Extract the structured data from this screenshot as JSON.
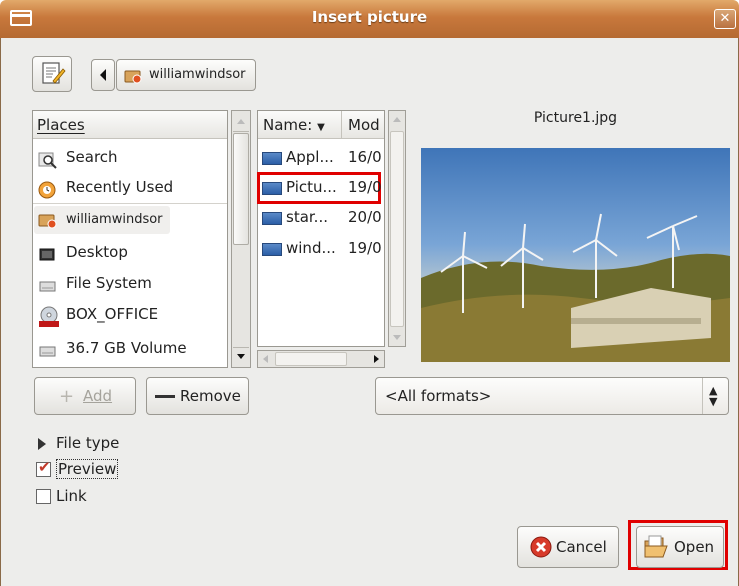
{
  "window": {
    "title": "Insert picture"
  },
  "location": {
    "breadcrumb": "williamwindsor"
  },
  "places": {
    "header": "Places",
    "items": [
      {
        "label": "Search",
        "icon": "search-icon"
      },
      {
        "label": "Recently Used",
        "icon": "recent-icon"
      },
      {
        "label": "williamwindsor",
        "icon": "home-folder-icon"
      },
      {
        "label": "Desktop",
        "icon": "desktop-icon"
      },
      {
        "label": "File System",
        "icon": "drive-icon"
      },
      {
        "label": "BOX_OFFICE",
        "icon": "cdrom-icon"
      },
      {
        "label": "36.7 GB Volume",
        "icon": "drive-icon"
      }
    ]
  },
  "files": {
    "columns": {
      "name": "Name:",
      "modified": "Mod"
    },
    "rows": [
      {
        "name": "Appl...",
        "modified": "16/0"
      },
      {
        "name": "Pictu...",
        "modified": "19/0",
        "selected": true
      },
      {
        "name": "star...",
        "modified": "20/0"
      },
      {
        "name": "wind...",
        "modified": "19/0"
      }
    ]
  },
  "preview": {
    "filename": "Picture1.jpg"
  },
  "buttons": {
    "add": "Add",
    "remove": "Remove",
    "cancel": "Cancel",
    "open": "Open"
  },
  "filter": {
    "selected": "<All formats>"
  },
  "options": {
    "file_type": "File type",
    "preview": "Preview",
    "preview_checked": true,
    "link": "Link",
    "link_checked": false
  },
  "colors": {
    "titlebar": "#c8783c",
    "highlight": "#e00000",
    "selection": "#86abd9"
  }
}
